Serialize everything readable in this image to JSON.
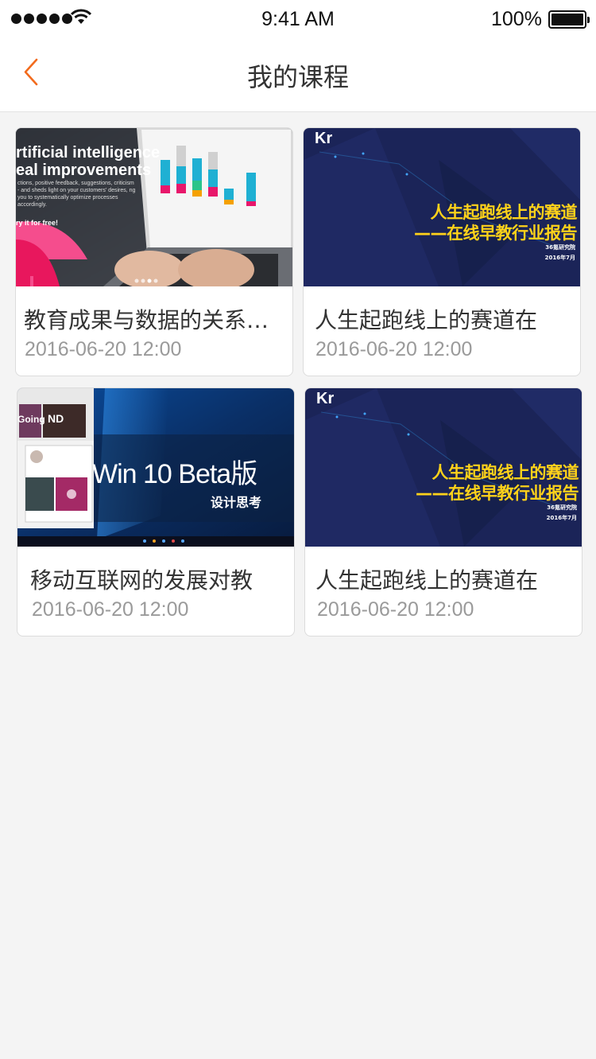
{
  "status_bar": {
    "time": "9:41 AM",
    "battery": "100%",
    "icons": [
      "signal-dots-icon",
      "wifi-icon",
      "battery-icon"
    ]
  },
  "nav": {
    "title": "我的课程",
    "back_icon": "chevron-left-icon",
    "accent_color": "#f26b1d"
  },
  "courses": [
    {
      "title": "教育成果与数据的关系数据",
      "date": "2016-06-20 12:00",
      "thumb": {
        "headline_1": "rtificial intelligence",
        "headline_2": "eal improvements",
        "body": "ctions, positive feedback, suggestions, criticism - and sheds light on your customers' desires, ng you to systematically optimize processes accordingly.",
        "cta": "ry it for free!"
      }
    },
    {
      "title": "人生起跑线上的赛道在",
      "date": "2016-06-20 12:00",
      "thumb": {
        "logo": "Kr",
        "line_1": "人生起跑线上的赛道",
        "line_2": "——在线早教行业报告",
        "org": "36氪研究院",
        "month": "2016年7月"
      }
    },
    {
      "title": "移动互联网的发展对教",
      "date": "2016-06-20 12:00",
      "thumb": {
        "headline": "Win 10 Beta版",
        "subtitle": "设计思考",
        "tile_1": "Going",
        "tile_2": "ND"
      }
    },
    {
      "title": "人生起跑线上的赛道在",
      "date": "2016-06-20 12:00",
      "thumb": {
        "logo": "Kr",
        "line_1": "人生起跑线上的赛道",
        "line_2": "——在线早教行业报告",
        "org": "36氪研究院",
        "month": "2016年7月"
      }
    }
  ]
}
